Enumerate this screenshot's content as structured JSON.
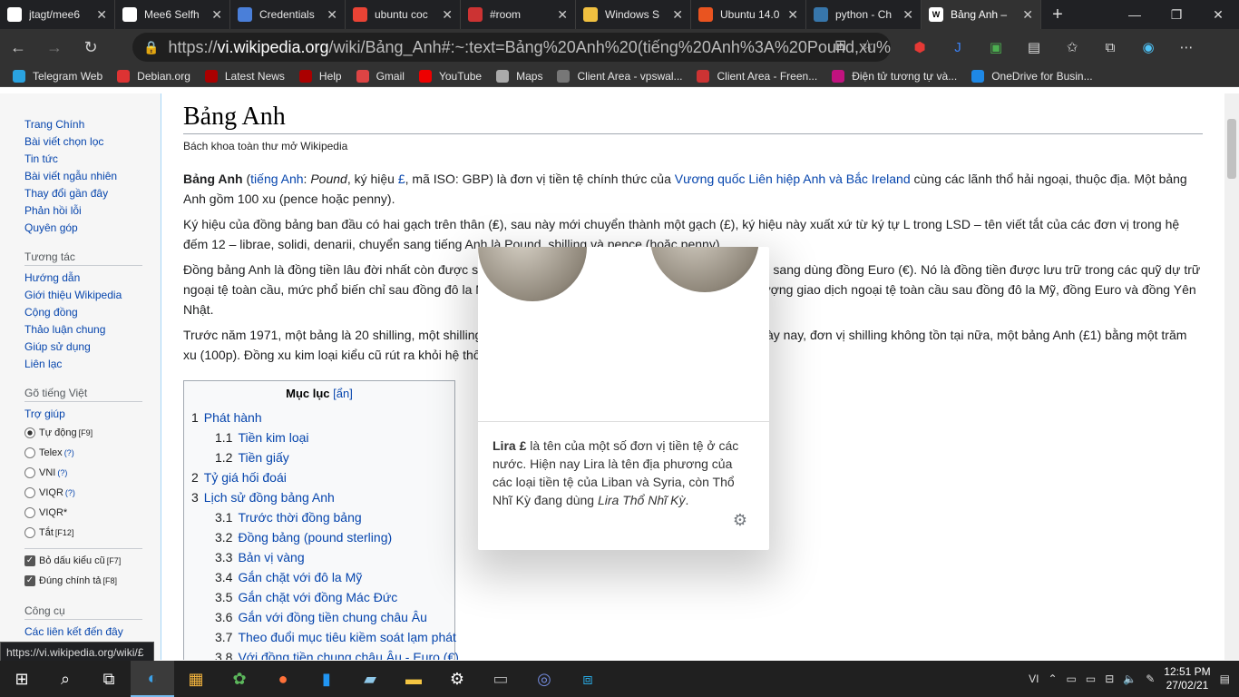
{
  "tabs": [
    {
      "label": "jtagt/mee6",
      "icon": "github-icon",
      "color": "#ffffff"
    },
    {
      "label": "Mee6 Selfh",
      "icon": "document-icon",
      "color": "#ffffff"
    },
    {
      "label": "Credentials",
      "icon": "api-icon",
      "color": "#4a7fd9"
    },
    {
      "label": "ubuntu coc",
      "icon": "google-icon",
      "color": "#ea4335"
    },
    {
      "label": "#room",
      "icon": "audio-icon",
      "color": "#cc3333"
    },
    {
      "label": "Windows S",
      "icon": "linux-icon",
      "color": "#f0c040"
    },
    {
      "label": "Ubuntu 14.0",
      "icon": "ubuntu-icon",
      "color": "#e95420"
    },
    {
      "label": "python - Ch",
      "icon": "python-icon",
      "color": "#3776ab"
    },
    {
      "label": "Bảng Anh –",
      "icon": "wikipedia-icon",
      "color": "#ffffff"
    }
  ],
  "address": {
    "prefix": "https://",
    "host": "vi.wikipedia.org",
    "path": "/wiki/Bảng_Anh#:~:text=Bảng%20Anh%20(tiếng%20Anh%3A%20Pound,xu%..."
  },
  "bookmarks": [
    "Telegram Web",
    "Debian.org",
    "Latest News",
    "Help",
    "Gmail",
    "YouTube",
    "Maps",
    "Client Area - vpswal...",
    "Client Area - Freen...",
    "Điện tử tương tự và...",
    "OneDrive for Busin..."
  ],
  "sidebar": {
    "nav": [
      "Trang Chính",
      "Bài viết chọn lọc",
      "Tin tức",
      "Bài viết ngẫu nhiên",
      "Thay đổi gần đây",
      "Phản hồi lỗi",
      "Quyên góp"
    ],
    "interact_title": "Tương tác",
    "interact": [
      "Hướng dẫn",
      "Giới thiệu Wikipedia",
      "Cộng đồng",
      "Thảo luận chung",
      "Giúp sử dụng",
      "Liên lạc"
    ],
    "typing_title": "Gõ tiếng Việt",
    "help": "Trợ giúp",
    "radios": [
      {
        "label": "Tự động",
        "key": "[F9]"
      },
      {
        "label": "Telex",
        "key": "(?)"
      },
      {
        "label": "VNI",
        "key": "(?)"
      },
      {
        "label": "VIQR",
        "key": "(?)"
      },
      {
        "label": "VIQR*",
        "key": ""
      },
      {
        "label": "Tắt",
        "key": "[F12]"
      }
    ],
    "checks": [
      {
        "label": "Bỏ dấu kiểu cũ",
        "key": "[F7]"
      },
      {
        "label": "Đúng chính tả",
        "key": "[F8]"
      }
    ],
    "tools_title": "Công cụ",
    "tools_first": "Các liên kết đến đây"
  },
  "article": {
    "title": "Bảng Anh",
    "subtitle": "Bách khoa toàn thư mở Wikipedia",
    "p1": "Bảng Anh (tiếng Anh: Pound, ký hiệu £, mã ISO: GBP) là đơn vị tiền tệ chính thức của Vương quốc Liên hiệp Anh và Bắc Ireland cùng các lãnh thổ hải ngoại, thuộc địa. Một bảng Anh gồm 100 xu (pence hoặc penny).",
    "p2": "Ký hiệu của đồng bảng ban đầu có hai gạch trên thân (₤), sau này mới chuyển thành một gạch (£), ký hiệu này xuất xứ từ ký tự L trong LSD – tên viết tắt của các đơn vị trong hệ đếm 12 – librae, solidi, denarii, chuyển sang tiếng Anh là Pound, shilling và pence (hoặc penny).",
    "p3": "Đồng bảng Anh là đồng tiền lâu đời nhất còn được sử dụng trong số các quốc gia thuộc khối EU chuyển sang dùng đồng Euro (€). Nó là đồng tiền được lưu trữ trong các quỹ dự trữ ngoại tệ toàn cầu, mức phổ biến chỉ sau đồng đô la Mỹ và đồng Euro. Đồng bảng đứng thứ tư về khối lượng giao dịch ngoại tệ toàn cầu sau đồng đô la Mỹ, đồng Euro và đồng Yên Nhật.",
    "p4": "Trước năm 1971, một bảng là 20 shilling, một shilling là 12 xu (pence). Như vậy một bảng là 240 xu. Ngày nay, đơn vị shilling không tồn tại nữa, một bảng Anh (£1) bằng một trăm xu (100p). Đồng xu kim loại kiểu cũ rút ra khỏi hệ thống thanh toán năm 1980."
  },
  "toc": {
    "title": "Mục lục",
    "hide": "[ẩn]",
    "items": [
      {
        "num": "1",
        "label": "Phát hành",
        "level": 1
      },
      {
        "num": "1.1",
        "label": "Tiền kim loại",
        "level": 2
      },
      {
        "num": "1.2",
        "label": "Tiền giấy",
        "level": 2
      },
      {
        "num": "2",
        "label": "Tỷ giá hối đoái",
        "level": 1
      },
      {
        "num": "3",
        "label": "Lịch sử đồng bảng Anh",
        "level": 1
      },
      {
        "num": "3.1",
        "label": "Trước thời đồng bảng",
        "level": 2
      },
      {
        "num": "3.2",
        "label": "Đồng bảng (pound sterling)",
        "level": 2
      },
      {
        "num": "3.3",
        "label": "Bản vị vàng",
        "level": 2
      },
      {
        "num": "3.4",
        "label": "Gắn chặt với đô la Mỹ",
        "level": 2
      },
      {
        "num": "3.5",
        "label": "Gắn chặt với đồng Mác Đức",
        "level": 2
      },
      {
        "num": "3.6",
        "label": "Gắn với đồng tiền chung châu Âu",
        "level": 2
      },
      {
        "num": "3.7",
        "label": "Theo đuổi mục tiêu kiềm soát lạm phát",
        "level": 2
      },
      {
        "num": "3.8",
        "label": "Với đồng tiền chung châu Âu - Euro (€)",
        "level": 2
      }
    ]
  },
  "popup": {
    "bold": "Lira £",
    "text": " là tên của một số đơn vị tiền tệ ở các nước. Hiện nay Lira là tên địa phương của các loại tiền tệ của Liban và Syria, còn Thổ Nhĩ Kỳ đang dùng ",
    "italic": "Lira Thổ Nhĩ Kỳ",
    "end": "."
  },
  "status_url": "https://vi.wikipedia.org/wiki/£",
  "taskbar": {
    "lang": "VI",
    "time": "12:51 PM",
    "date": "27/02/21"
  }
}
